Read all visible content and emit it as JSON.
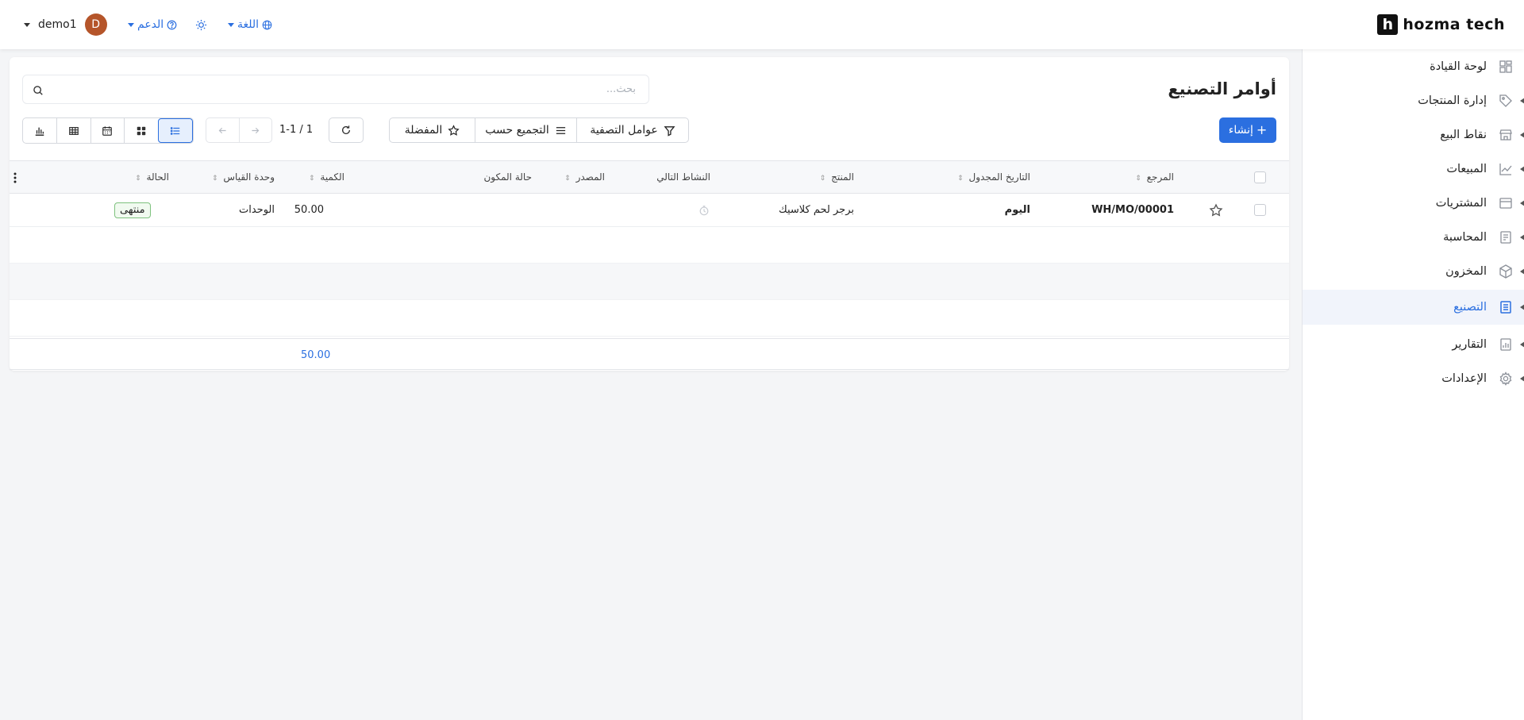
{
  "brand": {
    "mark": "h",
    "name": "hozma tech"
  },
  "topbar": {
    "user": "demo1",
    "avatar_letter": "D",
    "support": "الدعم",
    "language": "اللغة"
  },
  "sidebar": {
    "items": [
      {
        "label": "لوحة القيادة",
        "icon": "dashboard-icon"
      },
      {
        "label": "إدارة المنتجات",
        "icon": "tag-icon"
      },
      {
        "label": "نقاط البيع",
        "icon": "store-icon"
      },
      {
        "label": "المبيعات",
        "icon": "chart-line-icon"
      },
      {
        "label": "المشتريات",
        "icon": "purchase-icon"
      },
      {
        "label": "المحاسبة",
        "icon": "accounting-icon"
      },
      {
        "label": "المخزون",
        "icon": "box-icon"
      },
      {
        "label": "التصنيع",
        "icon": "manufacturing-icon",
        "active": true
      },
      {
        "label": "التقارير",
        "icon": "report-icon"
      },
      {
        "label": "الإعدادات",
        "icon": "gear-icon"
      }
    ]
  },
  "page": {
    "title": "أوامر التصنيع",
    "search_placeholder": "بحث...",
    "create_label": "إنشاء",
    "filters_label": "عوامل التصفية",
    "groupby_label": "التجميع حسب",
    "favorites_label": "المفضلة",
    "pager": "1-1 / 1"
  },
  "table": {
    "columns": [
      "المرجع",
      "التاريخ المجدول",
      "المنتج",
      "النشاط التالي",
      "المصدر",
      "حالة المكون",
      "الكمية",
      "وحدة القياس",
      "الحالة"
    ],
    "rows": [
      {
        "reference": "WH/MO/00001",
        "date": "اليوم",
        "product": "برجر لحم كلاسيك",
        "quantity": "50.00",
        "uom": "الوحدات",
        "status": "منتهى"
      }
    ],
    "total_quantity": "50.00"
  },
  "colors": {
    "accent": "#2b6fe0",
    "avatar": "#b5552a",
    "done_badge": "#7ec27e"
  }
}
